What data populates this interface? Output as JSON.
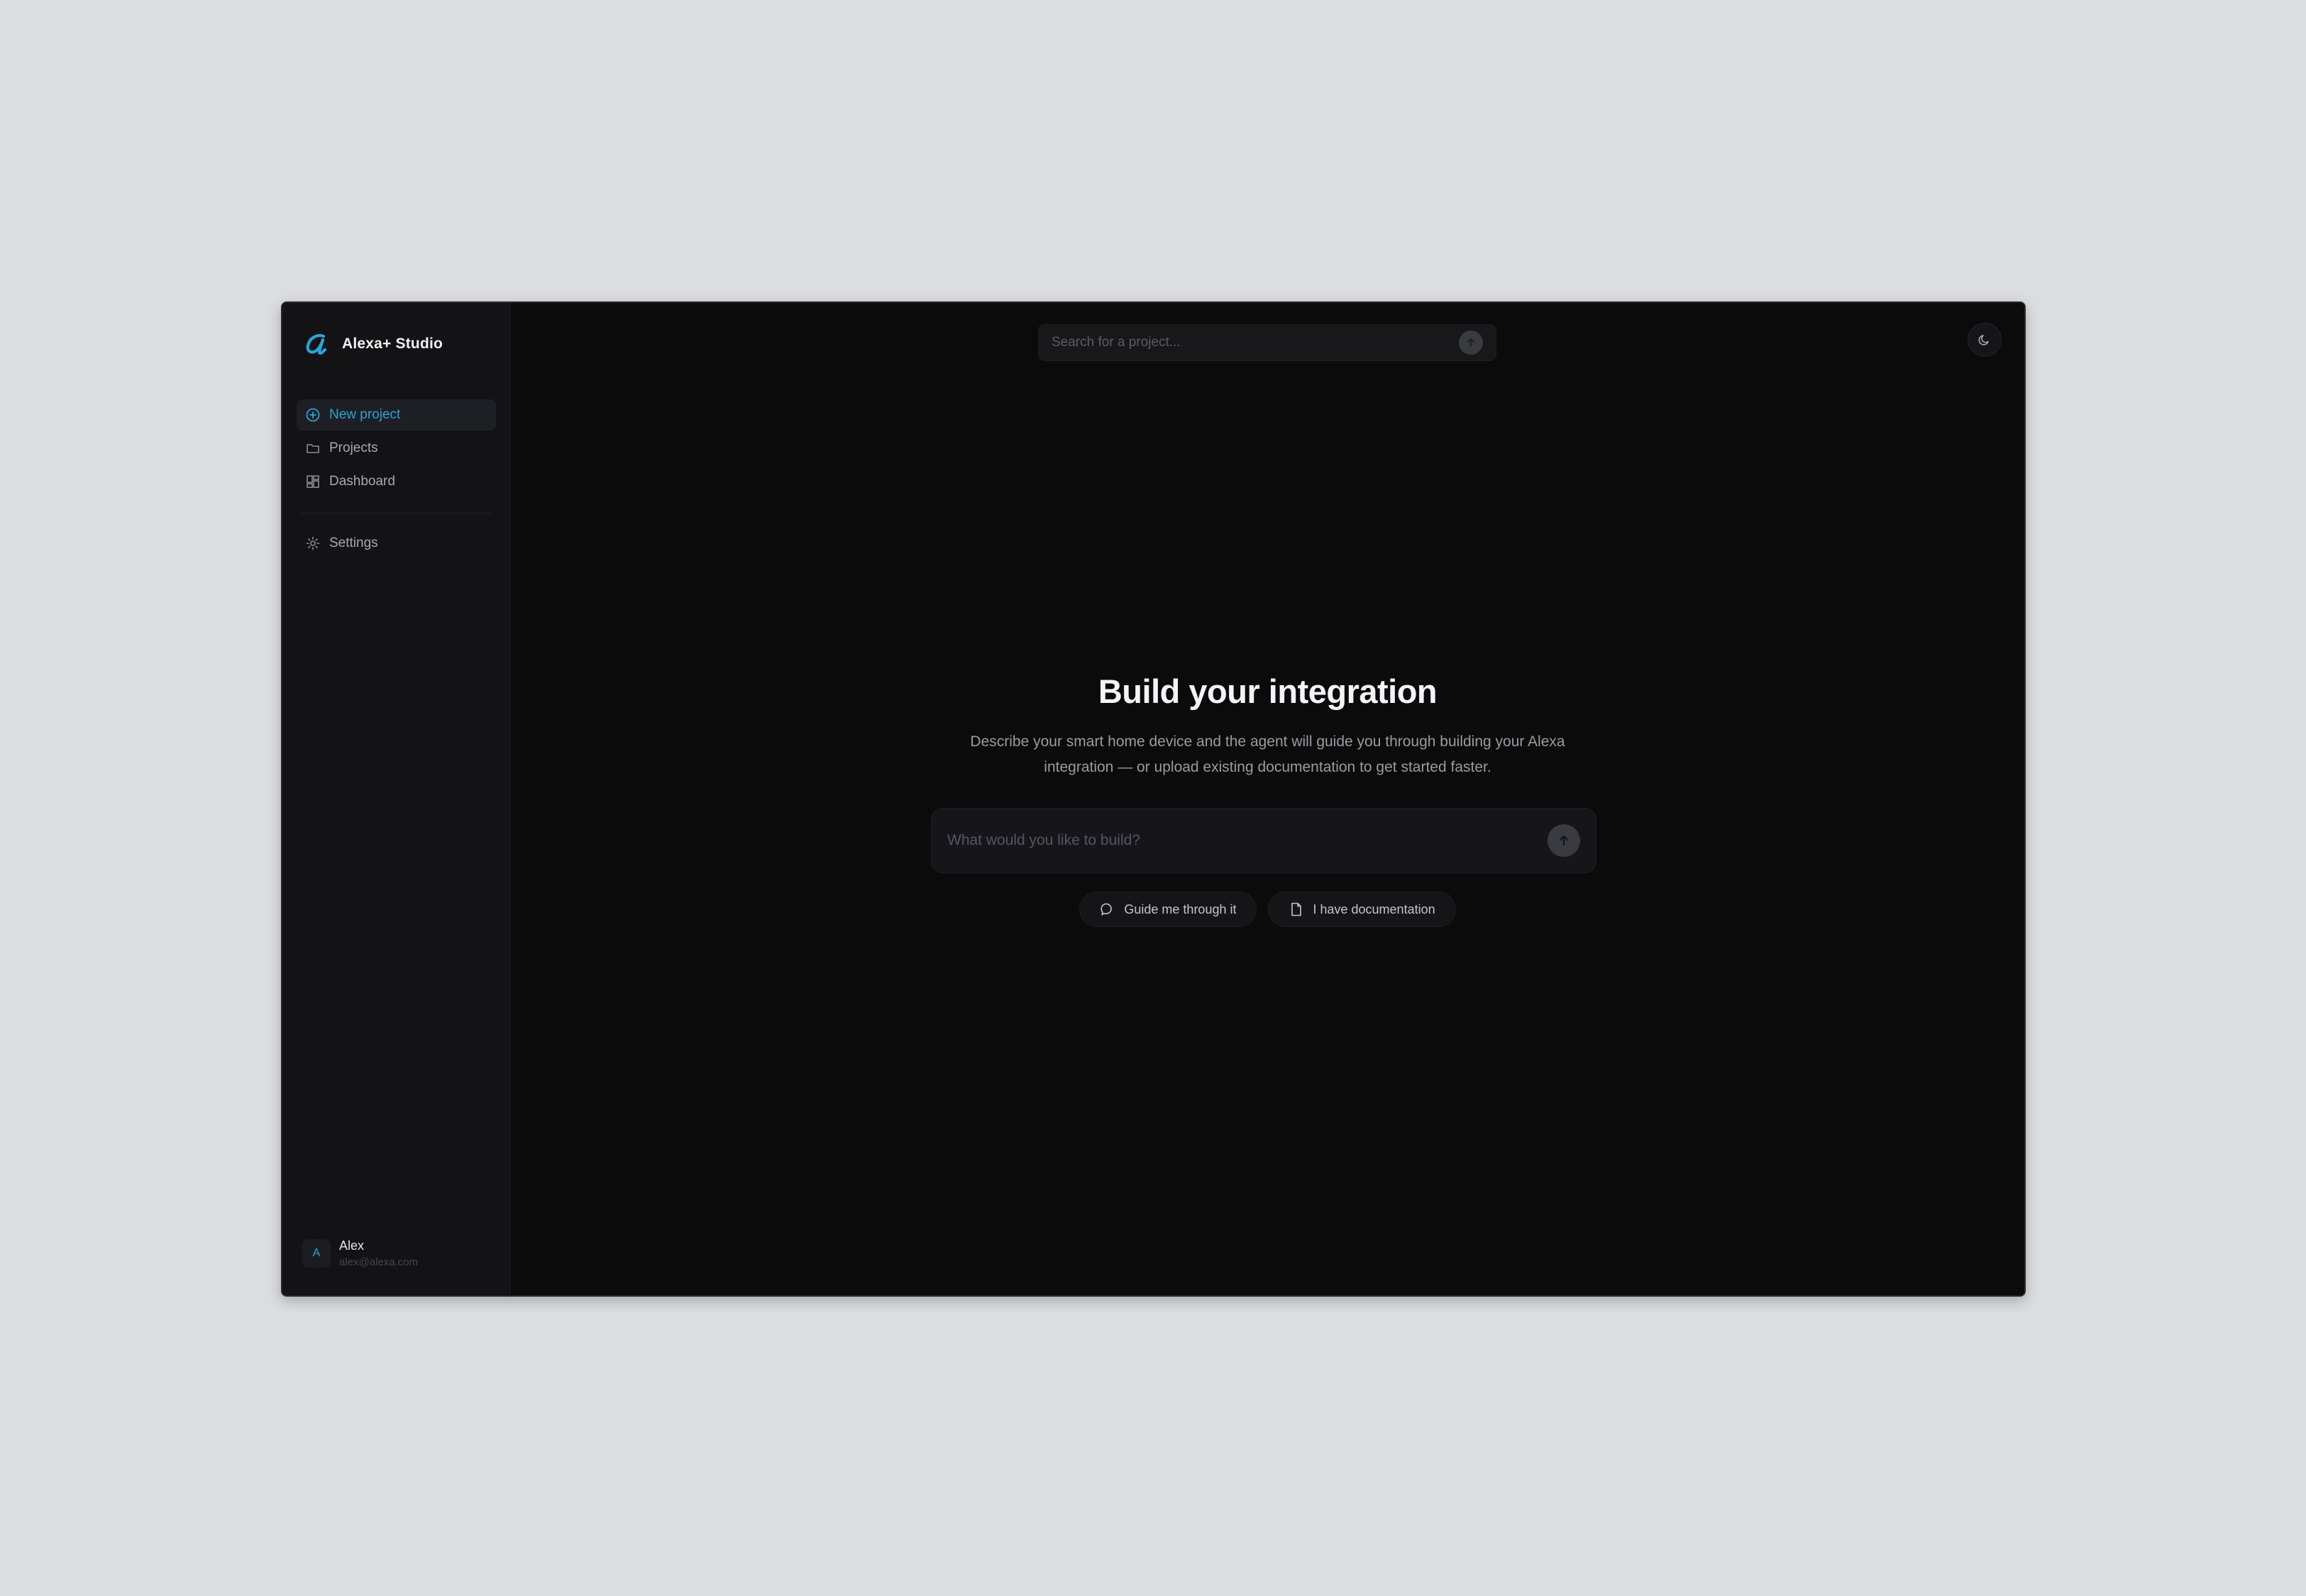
{
  "app": {
    "title": "Alexa+ Studio",
    "accent_color": "#2aa3d8",
    "logo_icon": "alexa-logo-icon"
  },
  "sidebar": {
    "items": [
      {
        "label": "New project",
        "icon": "plus-circle-icon",
        "active": true
      },
      {
        "label": "Projects",
        "icon": "folder-icon",
        "active": false
      },
      {
        "label": "Dashboard",
        "icon": "dashboard-grid-icon",
        "active": false
      }
    ],
    "secondary_items": [
      {
        "label": "Settings",
        "icon": "gear-icon"
      }
    ],
    "user": {
      "initial": "A",
      "name": "Alex",
      "email": "alex@alexa.com"
    }
  },
  "header": {
    "search_placeholder": "Search for a project...",
    "search_button_icon": "arrow-up-icon",
    "theme_toggle_icon": "moon-icon"
  },
  "main": {
    "title": "Build your integration",
    "description": "Describe your smart home device and the agent will guide you through building your Alexa integration — or upload existing documentation to get started faster.",
    "prompt_placeholder": "What would you like to build?",
    "prompt_send_icon": "arrow-up-icon",
    "chips": [
      {
        "label": "Guide me through it",
        "icon": "chat-bubble-icon"
      },
      {
        "label": "I have documentation",
        "icon": "document-icon"
      }
    ]
  }
}
